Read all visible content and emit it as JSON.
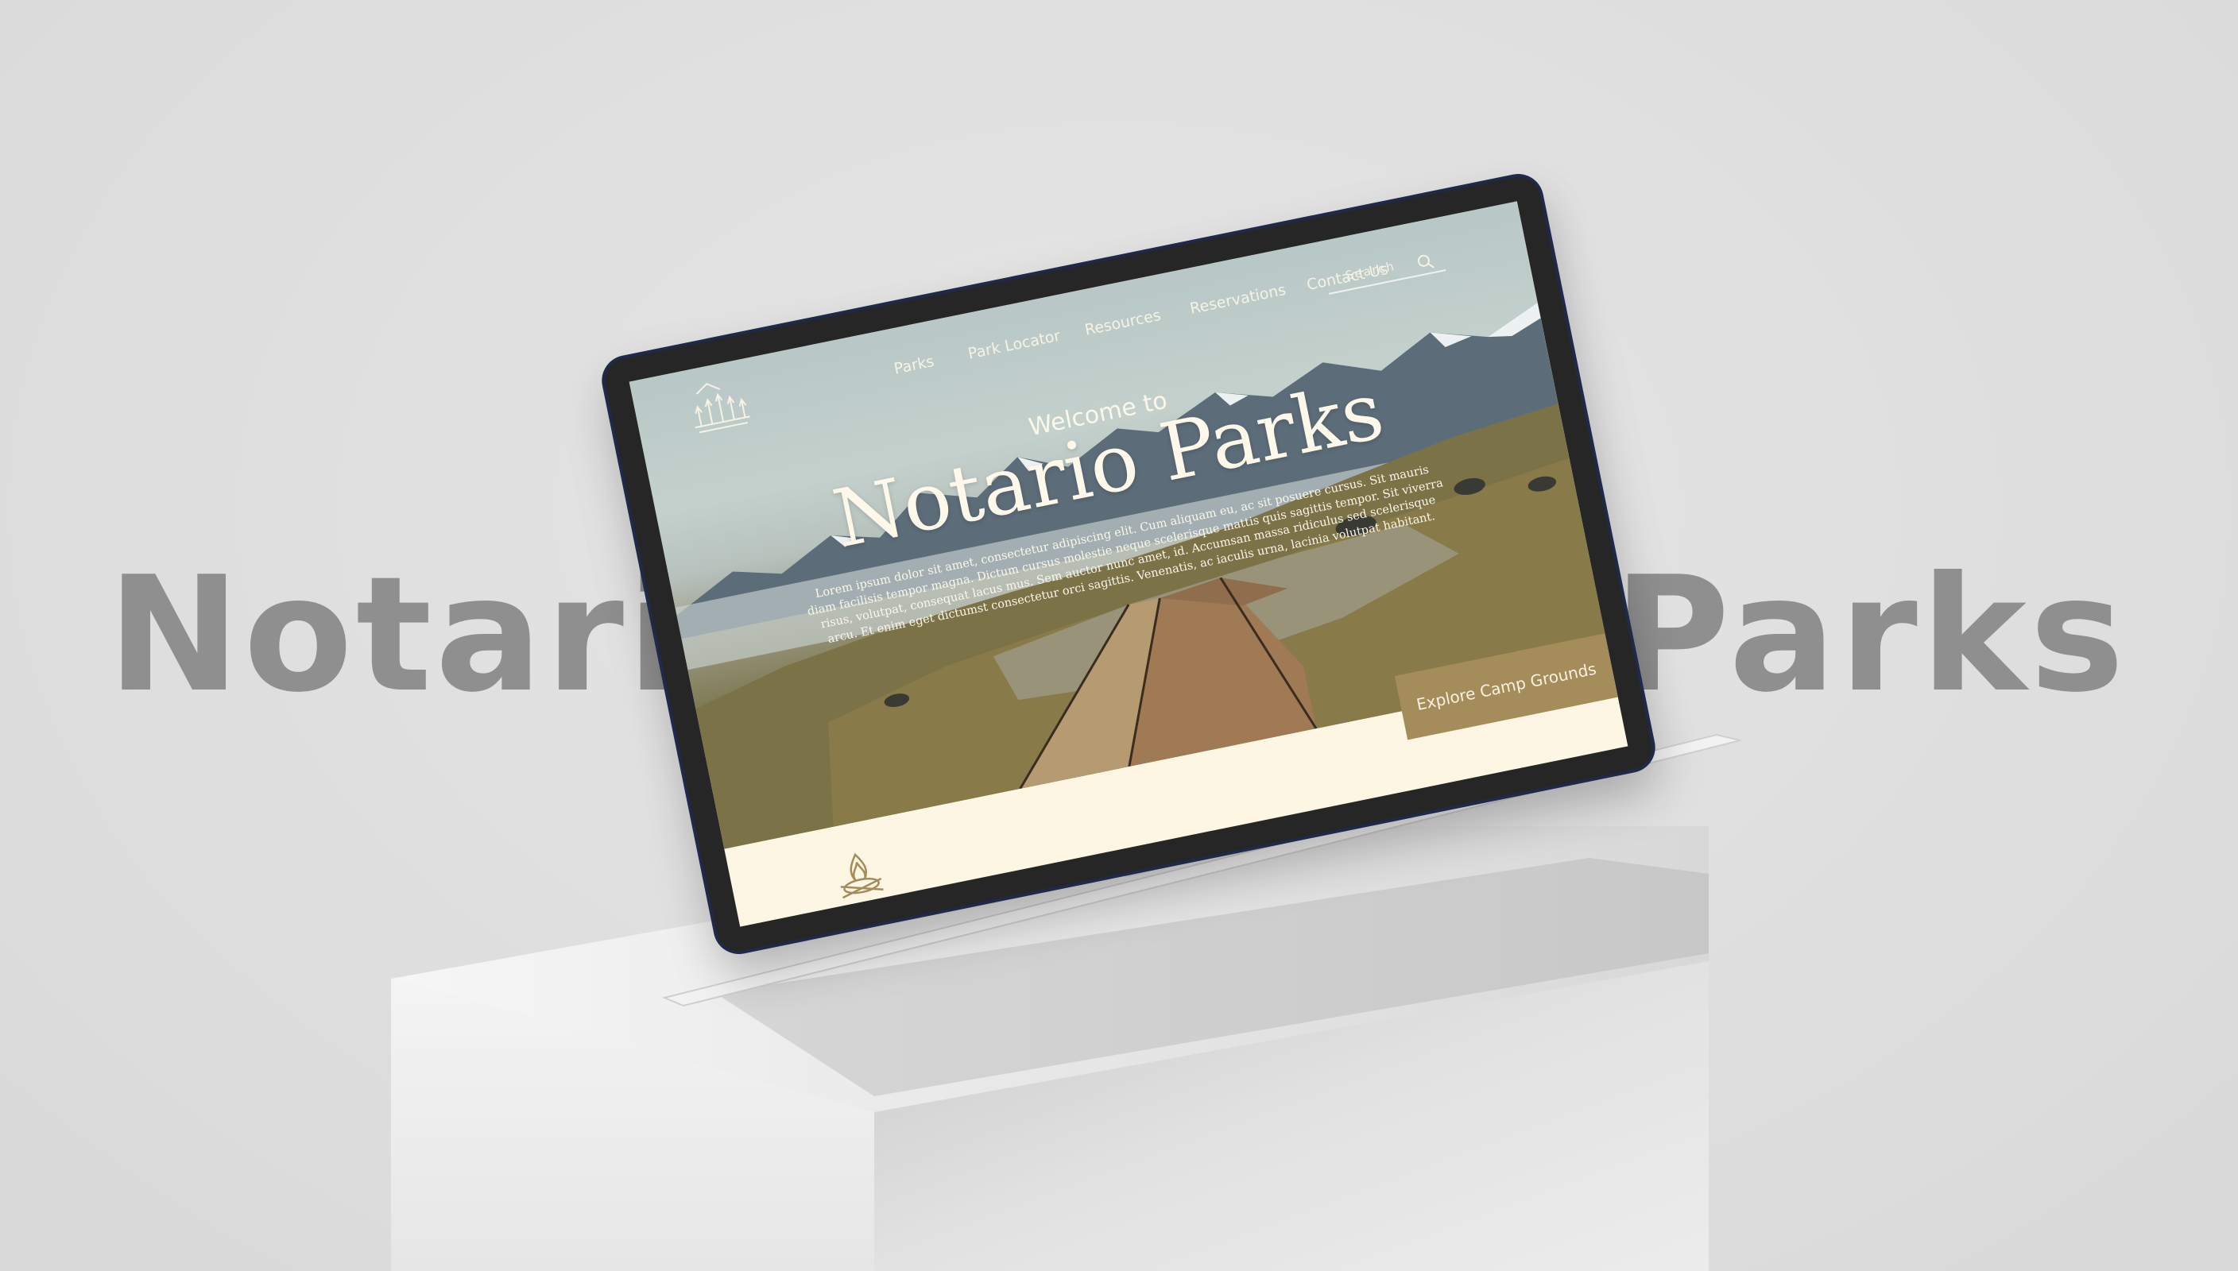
{
  "background": {
    "word_left": "Notario",
    "word_right": "Parks"
  },
  "site": {
    "nav": {
      "items": [
        "Parks",
        "Park Locator",
        "Resources",
        "Reservations",
        "Contact Us"
      ]
    },
    "search": {
      "placeholder": "Search",
      "icon": "search-icon"
    },
    "hero": {
      "welcome": "Welcome to",
      "title": "Notario Parks",
      "body": "Lorem ipsum dolor sit amet, consectetur adipiscing elit. Cum aliquam eu, ac sit posuere cursus. Sit mauris diam facilisis tempor magna. Dictum cursus molestie neque scelerisque mattis quis sagittis tempor. Sit viverra risus, volutpat, consequat lacus mus. Sem auctor nunc amet, id. Accumsan massa ridiculus sed scelerisque arcu. Et enim eget dictumst consectetur orci sagittis. Venenatis, ac iaculis urna, lacinia volutpat habitant."
    },
    "cta": {
      "label": "Explore Camp Grounds"
    },
    "icons": [
      "logo-icon",
      "search-icon",
      "campfire-icon"
    ]
  },
  "colors": {
    "accent": "#a58d5b",
    "cream": "#fdf6e3",
    "bezel": "#262626",
    "background_word": "#8f8f8f"
  }
}
